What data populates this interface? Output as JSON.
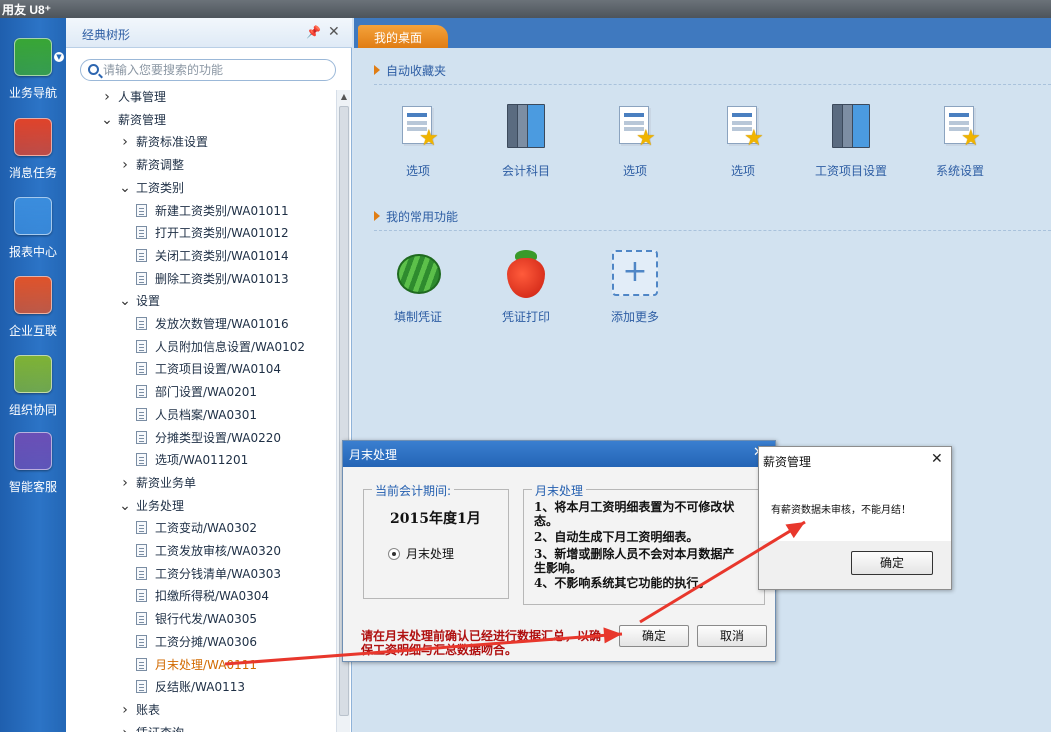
{
  "app": {
    "logo": "用友 U8⁺"
  },
  "rail": {
    "items": [
      {
        "label": "业务导航",
        "icon": "navigation-icon",
        "color": "#39a635"
      },
      {
        "label": "消息任务",
        "icon": "message-icon",
        "color": "#e0432a"
      },
      {
        "label": "报表中心",
        "icon": "report-icon",
        "color": "#3b8ddd"
      },
      {
        "label": "企业互联",
        "icon": "connect-icon",
        "color": "#e0532a"
      },
      {
        "label": "组织协同",
        "icon": "compass-icon",
        "color": "#7fb334"
      },
      {
        "label": "智能客服",
        "icon": "service-icon",
        "color": "#6b4fb6"
      }
    ]
  },
  "tree": {
    "title": "经典树形",
    "search_placeholder": "请输入您要搜索的功能",
    "rows": [
      {
        "label": "人事管理",
        "type": "collapsed",
        "level": 0
      },
      {
        "label": "薪资管理",
        "type": "expanded",
        "level": 0
      },
      {
        "label": "薪资标准设置",
        "type": "collapsed",
        "level": 1
      },
      {
        "label": "薪资调整",
        "type": "collapsed",
        "level": 1
      },
      {
        "label": "工资类别",
        "type": "expanded",
        "level": 1
      },
      {
        "label": "新建工资类别/WA01011",
        "type": "leaf",
        "level": 2
      },
      {
        "label": "打开工资类别/WA01012",
        "type": "leaf",
        "level": 2
      },
      {
        "label": "关闭工资类别/WA01014",
        "type": "leaf",
        "level": 2
      },
      {
        "label": "删除工资类别/WA01013",
        "type": "leaf",
        "level": 2
      },
      {
        "label": "设置",
        "type": "expanded",
        "level": 1
      },
      {
        "label": "发放次数管理/WA01016",
        "type": "leaf",
        "level": 2
      },
      {
        "label": "人员附加信息设置/WA0102",
        "type": "leaf",
        "level": 2
      },
      {
        "label": "工资项目设置/WA0104",
        "type": "leaf",
        "level": 2
      },
      {
        "label": "部门设置/WA0201",
        "type": "leaf",
        "level": 2
      },
      {
        "label": "人员档案/WA0301",
        "type": "leaf",
        "level": 2
      },
      {
        "label": "分摊类型设置/WA0220",
        "type": "leaf",
        "level": 2
      },
      {
        "label": "选项/WA011201",
        "type": "leaf",
        "level": 2
      },
      {
        "label": "薪资业务单",
        "type": "collapsed",
        "level": 1
      },
      {
        "label": "业务处理",
        "type": "expanded",
        "level": 1
      },
      {
        "label": "工资变动/WA0302",
        "type": "leaf",
        "level": 2
      },
      {
        "label": "工资发放审核/WA0320",
        "type": "leaf",
        "level": 2
      },
      {
        "label": "工资分钱清单/WA0303",
        "type": "leaf",
        "level": 2
      },
      {
        "label": "扣缴所得税/WA0304",
        "type": "leaf",
        "level": 2
      },
      {
        "label": "银行代发/WA0305",
        "type": "leaf",
        "level": 2
      },
      {
        "label": "工资分摊/WA0306",
        "type": "leaf",
        "level": 2
      },
      {
        "label": "月末处理/WA0111",
        "type": "leaf",
        "level": 2,
        "selected": true
      },
      {
        "label": "反结账/WA0113",
        "type": "leaf",
        "level": 2
      },
      {
        "label": "账表",
        "type": "collapsed",
        "level": 1
      },
      {
        "label": "凭证查询",
        "type": "collapsed",
        "level": 1
      }
    ]
  },
  "main": {
    "tab": "我的桌面",
    "favorites_title": "自动收藏夹",
    "favorites": [
      {
        "label": "选项",
        "icon": "doc-star-icon"
      },
      {
        "label": "会计科目",
        "icon": "books-icon"
      },
      {
        "label": "选项",
        "icon": "doc-star-icon"
      },
      {
        "label": "选项",
        "icon": "doc-star-icon"
      },
      {
        "label": "工资项目设置",
        "icon": "books-icon"
      },
      {
        "label": "系统设置",
        "icon": "doc-star-icon"
      }
    ],
    "common_title": "我的常用功能",
    "common": [
      {
        "label": "填制凭证",
        "icon": "watermelon-icon"
      },
      {
        "label": "凭证打印",
        "icon": "strawberry-icon"
      },
      {
        "label": "添加更多",
        "icon": "add-icon"
      }
    ]
  },
  "dialog_month_end": {
    "title": "月末处理",
    "period_legend": "当前会计期间:",
    "period": "2015年度1月",
    "option": "月末处理",
    "info_legend": "月末处理",
    "notes": [
      "1、将本月工资明细表置为不可修改状态。",
      "2、自动生成下月工资明细表。",
      "3、新增或删除人员不会对本月数据产生影响。",
      "4、不影响系统其它功能的执行。"
    ],
    "warning": "请在月末处理前确认已经进行数据汇总，以确保工资明细与汇总数据吻合。",
    "ok": "确定",
    "cancel": "取消"
  },
  "dialog_alert": {
    "title": "薪资管理",
    "message": "有薪资数据未审核，不能月结！",
    "ok": "确定"
  },
  "colors": {
    "annotation_arrow": "#e8372c",
    "tab_active": "#e98a1c",
    "rail": "#2b6fbf"
  }
}
